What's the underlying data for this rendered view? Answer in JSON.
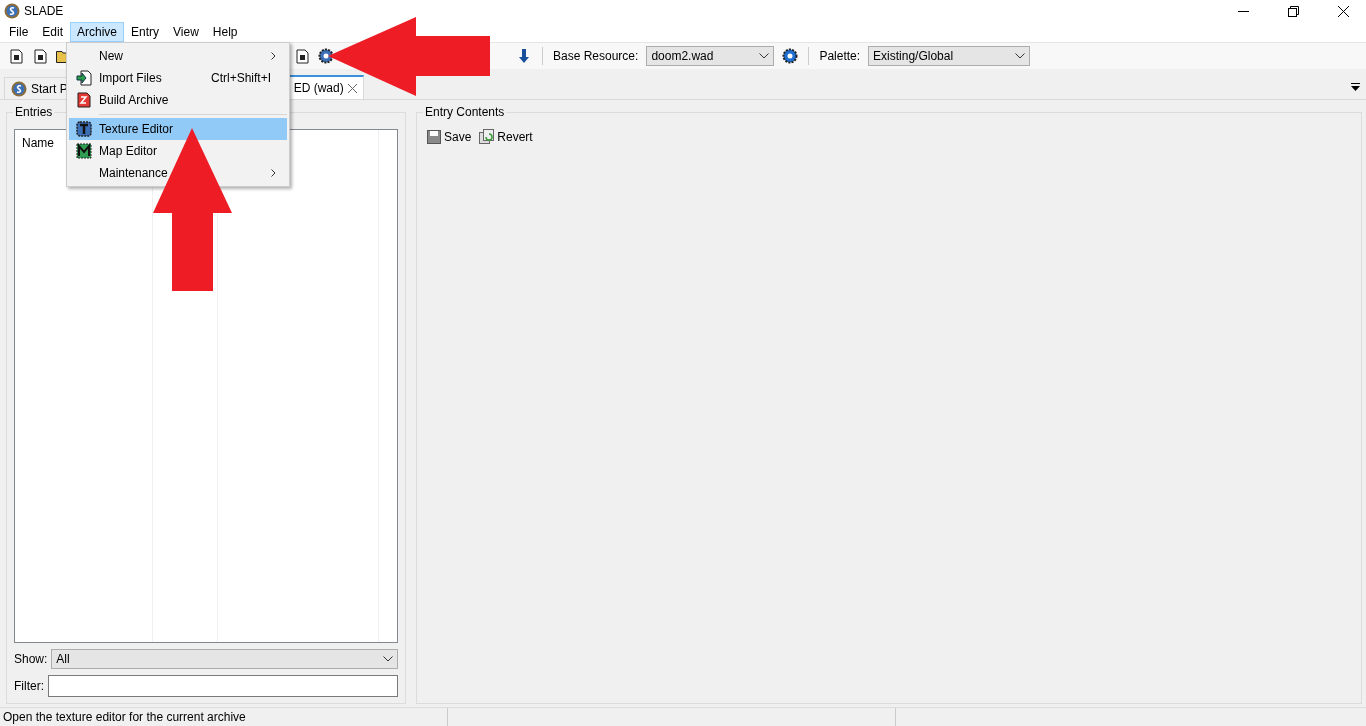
{
  "window": {
    "title": "SLADE"
  },
  "menu_bar": [
    {
      "label": "File",
      "selected": false
    },
    {
      "label": "Edit",
      "selected": false
    },
    {
      "label": "Archive",
      "selected": true
    },
    {
      "label": "Entry",
      "selected": false
    },
    {
      "label": "View",
      "selected": false
    },
    {
      "label": "Help",
      "selected": false
    }
  ],
  "archive_menu": [
    {
      "kind": "submenu",
      "label": "New",
      "selected": false
    },
    {
      "kind": "item",
      "label": "Import Files",
      "shortcut": "Ctrl+Shift+I",
      "selected": false
    },
    {
      "kind": "item",
      "label": "Build Archive",
      "selected": false
    },
    {
      "kind": "separator"
    },
    {
      "kind": "item",
      "label": "Texture Editor",
      "selected": true
    },
    {
      "kind": "item",
      "label": "Map Editor",
      "selected": false
    },
    {
      "kind": "submenu",
      "label": "Maintenance",
      "selected": false
    }
  ],
  "toolbar": {
    "base_resource": {
      "label": "Base Resource:",
      "value": "doom2.wad"
    },
    "palette": {
      "label": "Palette:",
      "value": "Existing/Global"
    }
  },
  "tabs": [
    {
      "label": "Start P",
      "selected": false
    },
    {
      "label": "ED (wad)",
      "selected": true
    }
  ],
  "entries_panel": {
    "title": "Entries",
    "columns": [
      "Name"
    ],
    "show": {
      "label": "Show:",
      "value": "All"
    },
    "filter": {
      "label": "Filter:"
    }
  },
  "entry_contents": {
    "title": "Entry Contents",
    "buttons": [
      "Save",
      "Revert"
    ]
  },
  "status_bar": [
    "Open the texture editor for the current archive"
  ]
}
